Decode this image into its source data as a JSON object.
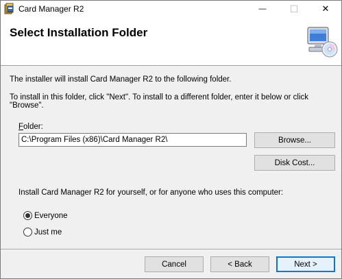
{
  "window": {
    "title": "Card Manager R2",
    "minimize_glyph": "—",
    "maximize_glyph": "☐",
    "close_glyph": "✕"
  },
  "banner": {
    "title": "Select Installation Folder",
    "icon": "computer-cd-icon"
  },
  "body": {
    "intro": "The installer will install Card Manager R2 to the following folder.",
    "instruction": "To install in this folder, click \"Next\". To install to a different folder, enter it below or click \"Browse\".",
    "folder_label_hotkey": "F",
    "folder_label_rest": "older:",
    "folder_value": "C:\\Program Files (x86)\\Card Manager R2\\",
    "browse_label": "Browse...",
    "disk_cost_label": "Disk Cost...",
    "install_for": "Install Card Manager R2 for yourself, or for anyone who uses this computer:",
    "options": [
      {
        "label": "Everyone",
        "selected": true
      },
      {
        "label": "Just me",
        "selected": false
      }
    ]
  },
  "footer": {
    "cancel_label": "Cancel",
    "back_label": "< Back",
    "next_label": "Next >"
  }
}
